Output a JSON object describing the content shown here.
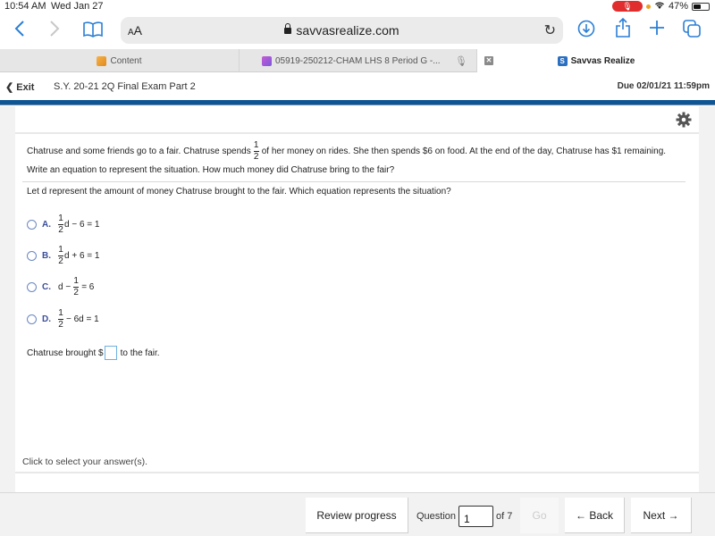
{
  "status_bar": {
    "time": "10:54 AM",
    "date": "Wed Jan 27",
    "battery_percent": "47%",
    "battery_level": 0.47
  },
  "browser": {
    "text_size_label": "AA",
    "url": "savvasrealize.com",
    "icons": {
      "back": "chevron-left-icon",
      "forward": "chevron-right-icon",
      "bookmarks": "book-icon",
      "lock": "lock-icon",
      "reload": "reload-icon",
      "downloads": "download-icon",
      "share": "share-icon",
      "new_tab": "plus-icon",
      "tabs": "tabs-icon"
    },
    "tabs": [
      {
        "label": "Content",
        "icon": "pencil-icon",
        "active": false
      },
      {
        "label": "05919-250212-CHAM LHS 8 Period G -...",
        "icon": "video-icon",
        "active": false
      },
      {
        "label": "Savvas Realize",
        "icon": "savvas-logo-icon",
        "active": true
      }
    ]
  },
  "app_header": {
    "exit_label": "Exit",
    "exam_title": "S.Y. 20-21 2Q Final Exam Part 2",
    "due": "Due 02/01/21 11:59pm"
  },
  "question": {
    "text_part1": "Chatruse and some friends go to a fair. Chatruse spends",
    "fraction": {
      "num": "1",
      "den": "2"
    },
    "text_part2": "of her money on rides. She then spends $6 on food. At the end of the day, Chatruse has $1 remaining.",
    "text_line2": "Write an equation to represent the situation. How much money did Chatruse bring to the fair?",
    "prompt": "Let d represent the amount of money Chatruse brought to the fair. Which equation represents the situation?",
    "options": [
      {
        "letter": "A.",
        "pre": "",
        "num": "1",
        "den": "2",
        "post": "d − 6 = 1"
      },
      {
        "letter": "B.",
        "pre": "",
        "num": "1",
        "den": "2",
        "post": "d + 6 = 1"
      },
      {
        "letter": "C.",
        "pre": "d −",
        "num": "1",
        "den": "2",
        "post": "= 6"
      },
      {
        "letter": "D.",
        "pre": "",
        "num": "1",
        "den": "2",
        "post": "− 6d = 1"
      }
    ],
    "answer_prefix": "Chatruse brought $",
    "answer_value": "",
    "answer_suffix": "to the fair.",
    "hint": "Click to select your answer(s)."
  },
  "footer": {
    "review_label": "Review progress",
    "question_label": "Question",
    "question_number": "1",
    "of_label": "of 7",
    "go_label": "Go",
    "back_label": "← Back",
    "next_label": "Next →"
  },
  "colors": {
    "brand_blue": "#0d5595",
    "link_blue": "#2b7fd6",
    "option_letter": "#3b4f9a"
  }
}
